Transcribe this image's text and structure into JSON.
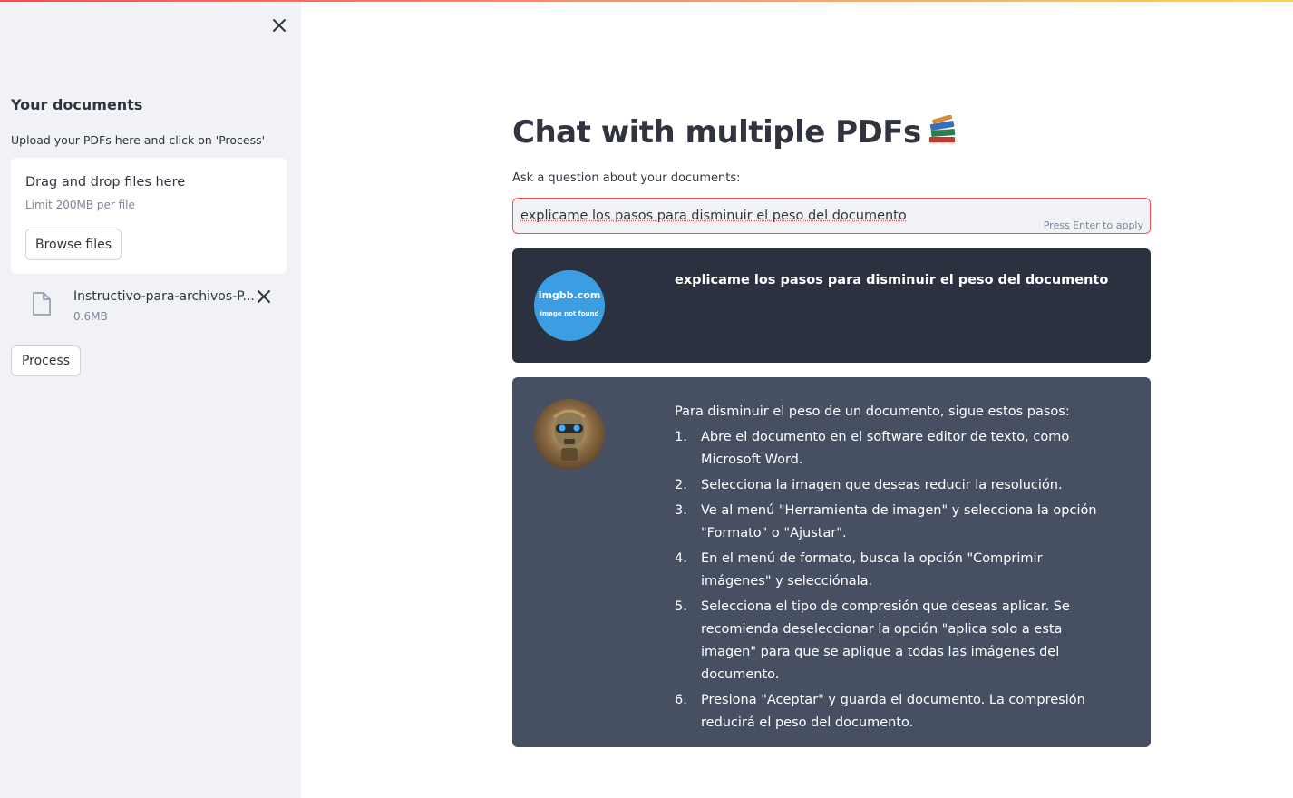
{
  "sidebar": {
    "title": "Your documents",
    "caption": "Upload your PDFs here and click on 'Process'",
    "dropzone": {
      "title": "Drag and drop files here",
      "limit": "Limit 200MB per file",
      "browse_label": "Browse files"
    },
    "file": {
      "name": "Instructivo-para-archivos-P...",
      "size": "0.6MB"
    },
    "process_label": "Process"
  },
  "main": {
    "title": "Chat with multiple PDFs",
    "title_icon": "books-icon",
    "question_label": "Ask a question about your documents:",
    "question_value": "explicame los pasos para disminuir el peso del documento",
    "question_hint": "Press Enter to apply"
  },
  "chat": {
    "user": {
      "avatar_line1": "imgbb.com",
      "avatar_line2": "image not found",
      "message": "explicame los pasos para disminuir el peso del documento"
    },
    "bot": {
      "avatar": "robot-avatar",
      "intro": "Para disminuir el peso de un documento, sigue estos pasos:",
      "steps": [
        "Abre el documento en el software editor de texto, como Microsoft Word.",
        "Selecciona la imagen que deseas reducir la resolución.",
        "Ve al menú \"Herramienta de imagen\" y selecciona la opción \"Formato\" o \"Ajustar\".",
        "En el menú de formato, busca la opción \"Comprimir imágenes\" y selecciónala.",
        "Selecciona el tipo de compresión que deseas aplicar. Se recomienda deseleccionar la opción \"aplica solo a esta imagen\" para que se aplique a todas las imágenes del documento.",
        "Presiona \"Aceptar\" y guarda el documento. La compresión reducirá el peso del documento."
      ],
      "step_numbers": [
        "1.",
        "2.",
        "3.",
        "4.",
        "5.",
        "6."
      ]
    }
  },
  "colors": {
    "accent": "#ff4b4b",
    "sidebar_bg": "#f0f2f6",
    "user_msg_bg": "#2b313e",
    "bot_msg_bg": "#475063"
  }
}
